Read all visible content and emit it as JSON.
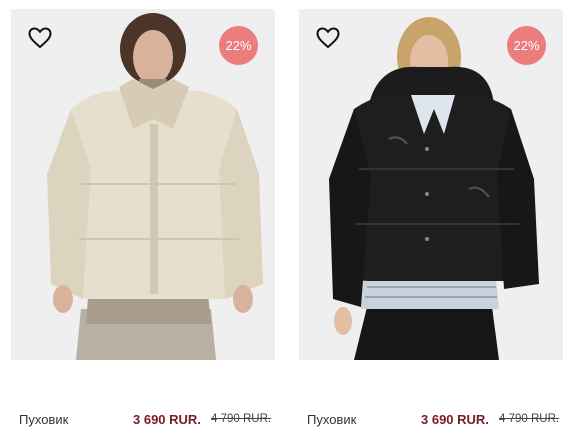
{
  "colors": {
    "badge_bg": "#ec7d7f",
    "price": "#7a1c28"
  },
  "products": [
    {
      "name": "Пуховик",
      "discount": "22%",
      "price": "3 690 RUR.",
      "old_price": "4 790 RUR.",
      "image": "model-in-cream-puffer-jacket",
      "favorite_icon": "heart-outline-icon"
    },
    {
      "name": "Пуховик",
      "discount": "22%",
      "price": "3 690 RUR.",
      "old_price": "4 790 RUR.",
      "image": "model-in-black-puffer-jacket",
      "favorite_icon": "heart-outline-icon"
    }
  ]
}
